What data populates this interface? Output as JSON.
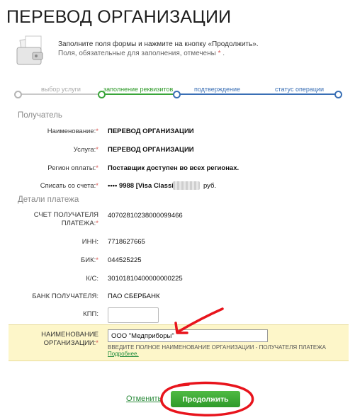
{
  "page": {
    "title": "ПЕРЕВОД ОРГАНИЗАЦИИ",
    "intro_line1": "Заполните поля формы и нажмите на кнопку «Продолжить».",
    "intro_line2": "Поля, обязательные для заполнения, отмечены",
    "required_mark": "*"
  },
  "progress": {
    "steps": [
      {
        "label": "выбор услуги",
        "state": "done"
      },
      {
        "label": "заполнение реквизитов",
        "state": "current"
      },
      {
        "label": "подтверждение",
        "state": "pending"
      },
      {
        "label": "статус операции",
        "state": "pending"
      }
    ]
  },
  "recipient": {
    "section_title": "Получатель",
    "fields": [
      {
        "label": "Наименование:",
        "value": "ПЕРЕВОД ОРГАНИЗАЦИИ"
      },
      {
        "label": "Услуга:",
        "value": "ПЕРЕВОД ОРГАНИЗАЦИИ"
      },
      {
        "label": "Регион оплаты:",
        "value": "Поставщик доступен во всех регионах."
      },
      {
        "label": "Списать со счета:",
        "value": "•••• 9988  [Visa Classic]",
        "suffix": "руб."
      }
    ]
  },
  "payment": {
    "section_title": "Детали платежа",
    "account_label_1": "СЧЕТ ПОЛУЧАТЕЛЯ",
    "account_label_2": "ПЛАТЕЖА:",
    "account_value": "40702810238000099466",
    "inn_label": "ИНН:",
    "inn_value": "7718627665",
    "bik_label": "БИК:",
    "bik_value": "044525225",
    "ks_label": "К/С:",
    "ks_value": "30101810400000000225",
    "bank_label": "БАНК ПОЛУЧАТЕЛЯ:",
    "bank_value": "ПАО СБЕРБАНК",
    "kpp_label": "КПП:",
    "kpp_value": "",
    "org_label_1": "НАИМЕНОВАНИЕ",
    "org_label_2": "ОРГАНИЗАЦИИ:",
    "org_value": "ООО \"Медприборы\"",
    "org_hint": "ВВЕДИТЕ ПОЛНОЕ НАИМЕНОВАНИЕ ОРГАНИЗАЦИИ - ПОЛУЧАТЕЛЯ ПЛАТЕЖА",
    "more_link": "Подробнее."
  },
  "actions": {
    "cancel_label": "Отменить",
    "continue_label": "Продолжить"
  },
  "colors": {
    "accent_green": "#2f9a2a",
    "highlight_yellow": "#fdf6c9",
    "annotation_red": "#e8141c",
    "progress_done": "#b5b5b5"
  }
}
